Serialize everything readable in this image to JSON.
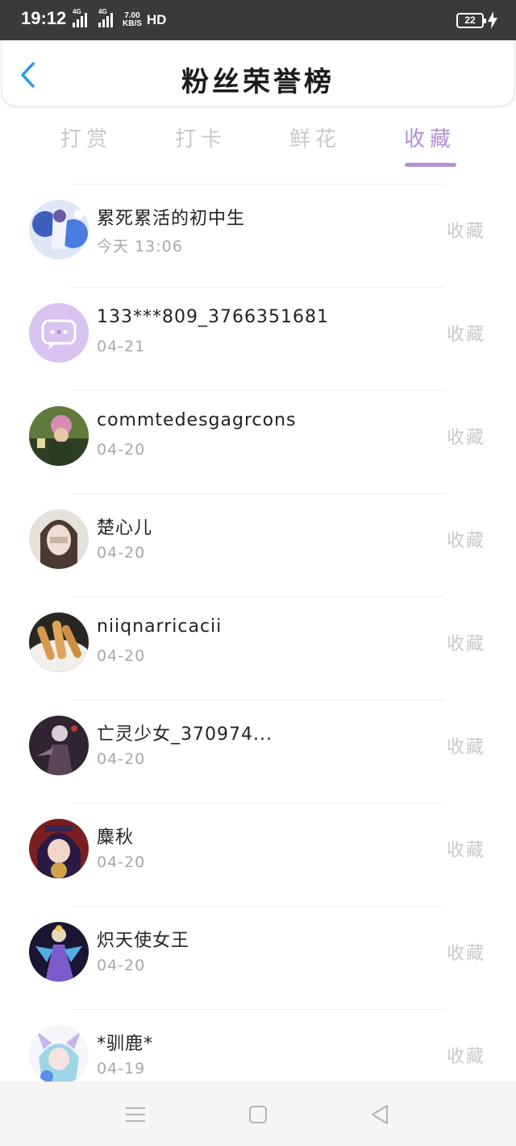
{
  "status_bar": {
    "time": "19:12",
    "network_1": "4G",
    "network_2": "4G",
    "speed_value": "7.00",
    "speed_unit": "KB/S",
    "hd": "HD",
    "battery": "22"
  },
  "header": {
    "title": "粉丝荣誉榜",
    "back_icon": "chevron-left-icon"
  },
  "tabs": [
    {
      "label": "打赏",
      "active": false
    },
    {
      "label": "打卡",
      "active": false
    },
    {
      "label": "鲜花",
      "active": false
    },
    {
      "label": "收藏",
      "active": true
    }
  ],
  "colors": {
    "accent": "#b48fd6",
    "back_arrow": "#2f9be6",
    "muted": "#c9c9c9"
  },
  "fans": [
    {
      "name": "累死累活的初中生",
      "date": "今天 13:06",
      "action": "收藏",
      "avatar": "anime-avatar-blue"
    },
    {
      "name": "133***809_3766351681",
      "date": "04-21",
      "action": "收藏",
      "avatar": "chat-bubble-avatar"
    },
    {
      "name": "commtedesgagrcons",
      "date": "04-20",
      "action": "收藏",
      "avatar": "photo-avatar-green"
    },
    {
      "name": "楚心儿",
      "date": "04-20",
      "action": "收藏",
      "avatar": "photo-avatar-girl"
    },
    {
      "name": "niiqnarricacii",
      "date": "04-20",
      "action": "收藏",
      "avatar": "photo-avatar-food"
    },
    {
      "name": "亡灵少女_370974...",
      "date": "04-20",
      "action": "收藏",
      "avatar": "anime-avatar-dark"
    },
    {
      "name": "麋秋",
      "date": "04-20",
      "action": "收藏",
      "avatar": "anime-avatar-red"
    },
    {
      "name": "炽天使女王",
      "date": "04-20",
      "action": "收藏",
      "avatar": "anime-avatar-purple"
    },
    {
      "name": "*驯鹿*",
      "date": "04-19",
      "action": "收藏",
      "avatar": "anime-avatar-light"
    }
  ],
  "nav_bar": [
    "menu-icon",
    "home-square-icon",
    "back-triangle-icon"
  ]
}
